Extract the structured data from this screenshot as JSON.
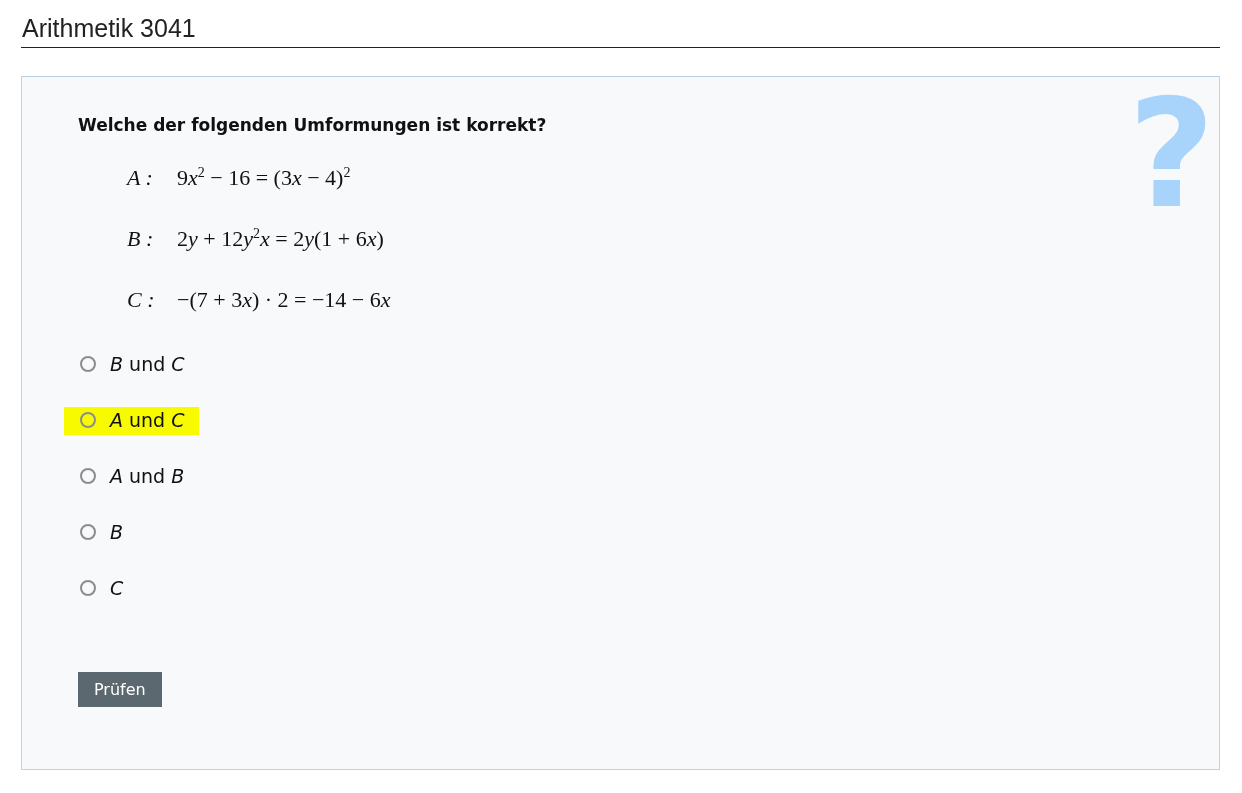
{
  "title": "Arithmetik 3041",
  "panel": {
    "decoration": "?",
    "question": "Welche der folgenden Umformungen ist korrekt?",
    "statements": [
      {
        "label": "A :",
        "formula": [
          {
            "kind": "plain",
            "text": "9"
          },
          {
            "kind": "var",
            "text": "x"
          },
          {
            "kind": "sup",
            "text": "2"
          },
          {
            "kind": "plain",
            "text": " − 16 = (3"
          },
          {
            "kind": "var",
            "text": "x"
          },
          {
            "kind": "plain",
            "text": " − 4)"
          },
          {
            "kind": "sup",
            "text": "2"
          }
        ]
      },
      {
        "label": "B :",
        "formula": [
          {
            "kind": "plain",
            "text": "2"
          },
          {
            "kind": "var",
            "text": "y"
          },
          {
            "kind": "plain",
            "text": " + 12"
          },
          {
            "kind": "var",
            "text": "y"
          },
          {
            "kind": "sup",
            "text": "2"
          },
          {
            "kind": "var",
            "text": "x"
          },
          {
            "kind": "plain",
            "text": " = 2"
          },
          {
            "kind": "var",
            "text": "y"
          },
          {
            "kind": "plain",
            "text": "(1 + 6"
          },
          {
            "kind": "var",
            "text": "x"
          },
          {
            "kind": "plain",
            "text": ")"
          }
        ]
      },
      {
        "label": "C :",
        "formula": [
          {
            "kind": "plain",
            "text": "−(7 + 3"
          },
          {
            "kind": "var",
            "text": "x"
          },
          {
            "kind": "plain",
            "text": ") · 2 = −14 − 6"
          },
          {
            "kind": "var",
            "text": "x"
          }
        ]
      }
    ],
    "options": [
      {
        "text": "*B* und *C*",
        "selected": false,
        "highlighted": false
      },
      {
        "text": "*A* und *C*",
        "selected": false,
        "highlighted": true
      },
      {
        "text": "*A* und *B*",
        "selected": false,
        "highlighted": false
      },
      {
        "text": "*B*",
        "selected": false,
        "highlighted": false
      },
      {
        "text": "*C*",
        "selected": false,
        "highlighted": false
      }
    ],
    "button": "Prüfen"
  }
}
